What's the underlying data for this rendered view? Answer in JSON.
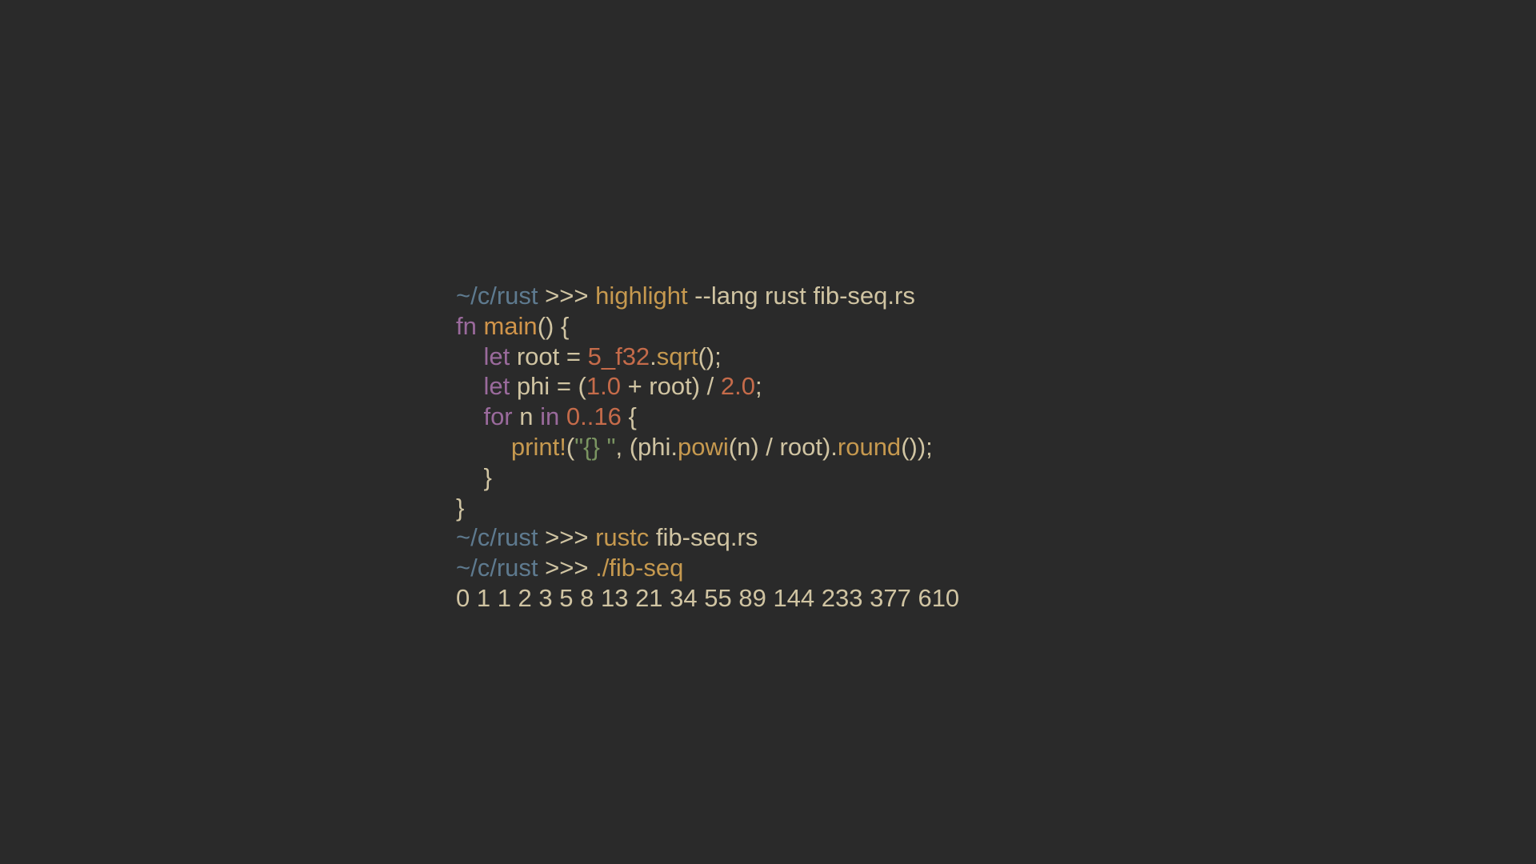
{
  "prompt": {
    "path": "~/c/rust",
    "sep": ">>>"
  },
  "lines": {
    "l1_cmd": "highlight",
    "l1_args": " --lang rust fib-seq.rs",
    "l2_kw_fn": "fn",
    "l2_fname": "main",
    "l2_paren_open": "()",
    "l2_brace": " {",
    "l3_indent": "    ",
    "l3_let": "let",
    "l3_ident": " root ",
    "l3_eq": "=",
    "l3_sp": " ",
    "l3_num": "5_f32",
    "l3_dot": ".",
    "l3_method": "sqrt",
    "l3_tail": "();",
    "l4_indent": "    ",
    "l4_let": "let",
    "l4_ident": " phi ",
    "l4_eq": "=",
    "l4_open": " (",
    "l4_one": "1.0",
    "l4_plus": " + root) / ",
    "l4_two": "2.0",
    "l4_tail": ";",
    "l5_indent": "    ",
    "l5_for": "for",
    "l5_n": " n ",
    "l5_in": "in",
    "l5_sp": " ",
    "l5_range": "0..16",
    "l5_brace": " {",
    "l6_indent": "        ",
    "l6_macro": "print!",
    "l6_open": "(",
    "l6_str": "\"{} \"",
    "l6_mid1": ", (phi.",
    "l6_powi": "powi",
    "l6_mid2": "(n) / root).",
    "l6_round": "round",
    "l6_tail": "());",
    "l7": "    }",
    "l8": "}",
    "l9_cmd": "rustc",
    "l9_args": " fib-seq.rs",
    "l10_cmd": "./fib-seq",
    "output": "0 1 1 2 3 5 8 13 21 34 55 89 144 233 377 610"
  }
}
